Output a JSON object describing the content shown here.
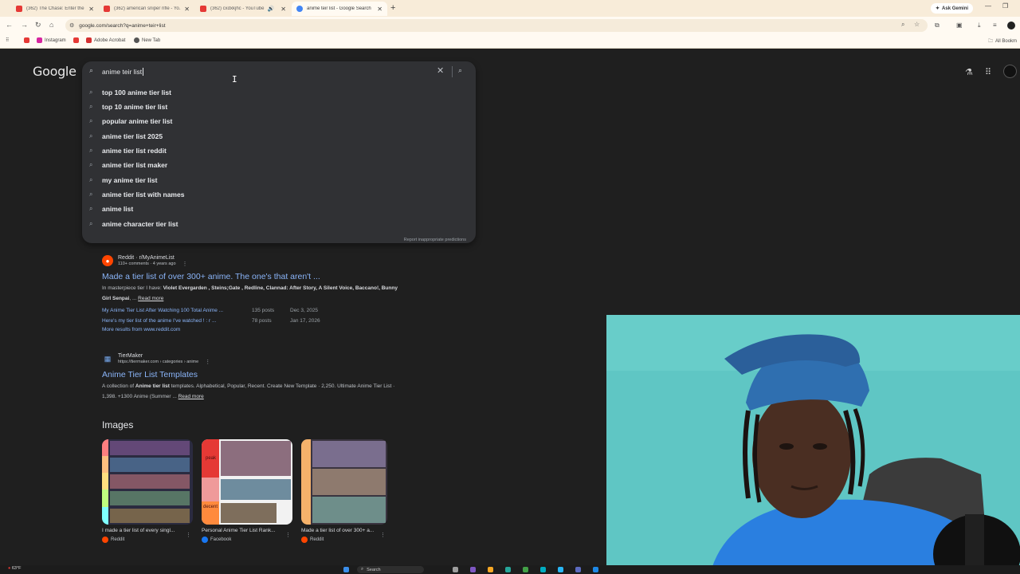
{
  "tabs": [
    {
      "title": "(362) The Chase: Enter the Tri...",
      "color": "#e53935",
      "active": false
    },
    {
      "title": "(362) american sniper rifle - Yo...",
      "color": "#e53935",
      "active": false
    },
    {
      "title": "(362) cxdxkjhc - YouTube",
      "color": "#e53935",
      "active": false
    },
    {
      "title": "anime teir list - Google Search",
      "color": "#4285f4",
      "active": true
    }
  ],
  "new_tab_symbol": "+",
  "ask_gemini": "Ask Gemini",
  "address_bar": "google.com/search?q=anime+teir+list",
  "bookmarks": [
    {
      "label": "",
      "color": "#e53935"
    },
    {
      "label": "Instagram",
      "color": "#d6249f"
    },
    {
      "label": "",
      "color": "#e53935"
    },
    {
      "label": "Adobe Acrobat",
      "color": "#d32f2f"
    },
    {
      "label": "New Tab",
      "color": "#555555"
    }
  ],
  "all_bookmarks": "All Bookm",
  "google_logo": "Google",
  "search": {
    "query": "anime teir list",
    "suggestions": [
      "top 100 anime tier list",
      "top 10 anime tier list",
      "popular anime tier list",
      "anime tier list 2025",
      "anime tier list reddit",
      "anime tier list maker",
      "my anime tier list",
      "anime tier list with names",
      "anime list",
      "anime character tier list"
    ],
    "report_link": "Report inappropriate predictions"
  },
  "results": [
    {
      "source": "Reddit · r/MyAnimeList",
      "meta": "110+ comments · 4 years ago",
      "title": "Made a tier list of over 300+ anime. The one's that aren't ...",
      "snippet_pre": "In masterpiece tier I have: ",
      "snippet_bold": "Violet Evergarden , Steins;Gate , Redline, Clannad: After Story, A Silent Voice, Baccano!, Bunny Girl Senpai",
      "snippet_post": ", ...",
      "read_more": "Read more",
      "sublinks": [
        {
          "title": "My Anime Tier List After Watching 100 Total Anime ...",
          "count": "135 posts",
          "date": "Dec 3, 2025"
        },
        {
          "title": "Here's my tier list of the anime I've watched ! : r ...",
          "count": "78 posts",
          "date": "Jan 17, 2026"
        }
      ],
      "more": "More results from www.reddit.com"
    },
    {
      "source": "TierMaker",
      "meta": "https://tiermaker.com › categories › anime",
      "title": "Anime Tier List Templates",
      "snippet_pre": "A collection of ",
      "snippet_bold": "Anime tier list",
      "snippet_post": " templates. Alphabetical, Popular, Recent. Create New Template · 2,250. Ultimate Anime Tier List · 1,398. +1300 Anime (Summer ...",
      "read_more": "Read more"
    }
  ],
  "images_heading": "Images",
  "image_cards": [
    {
      "caption": "I made a tier list of every singl...",
      "source": "Reddit",
      "dot": "#ff4500"
    },
    {
      "caption": "Personal Anime Tier List Rank...",
      "source": "Facebook",
      "dot": "#1877f2"
    },
    {
      "caption": "Made a tier list of over 300+ a...",
      "source": "Reddit",
      "dot": "#ff4500"
    }
  ],
  "tier_labels": [
    "peak",
    "decent"
  ],
  "taskbar": {
    "search_placeholder": "Search",
    "weather": "63°F"
  }
}
